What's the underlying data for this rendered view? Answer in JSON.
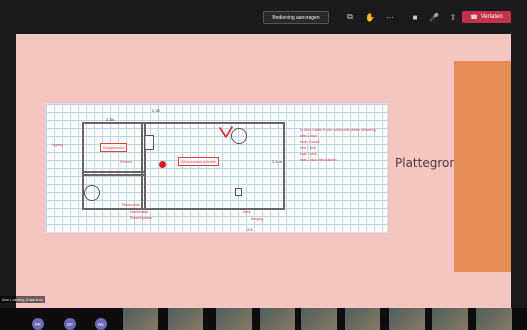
{
  "toolbar": {
    "control_request": "Bediening aanvragen",
    "leave_label": "Verlaten",
    "icons": [
      "screen-share-icon",
      "hand-icon",
      "more-icon",
      "camera-icon",
      "mic-icon",
      "share-tray-icon",
      "phone-leave-icon"
    ]
  },
  "slide": {
    "title": "Plattegrond",
    "accent_color": "#e68d55",
    "background_color": "#f4c5c1"
  },
  "floorplan": {
    "top_dimension": "2,35",
    "left_dimension": "2,35",
    "side_dimension": "2,5 m",
    "bottom_dimension": "2,5",
    "room_labels": [
      "Slaapkamer",
      "Woonkamer/zithoek"
    ],
    "notes": [
      "In deze ruimte is een voldoende plaats aanwezig",
      "tafel 1 stuk",
      "stoel 4 stuks",
      "bed 1 stuk",
      "kast 1 stuk",
      "kast 1 stuk met planken"
    ],
    "captions": [
      "Ingang",
      "Keuken",
      "Plantenbak",
      "Nachtkastje",
      "Rolstoelplaats",
      "Deur",
      "Berging"
    ]
  },
  "participants": [
    {
      "initials": "PK"
    },
    {
      "initials": "DF"
    },
    {
      "initials": "WL"
    }
  ],
  "presenter": {
    "label": "Ann Loening (Haarlem)"
  }
}
